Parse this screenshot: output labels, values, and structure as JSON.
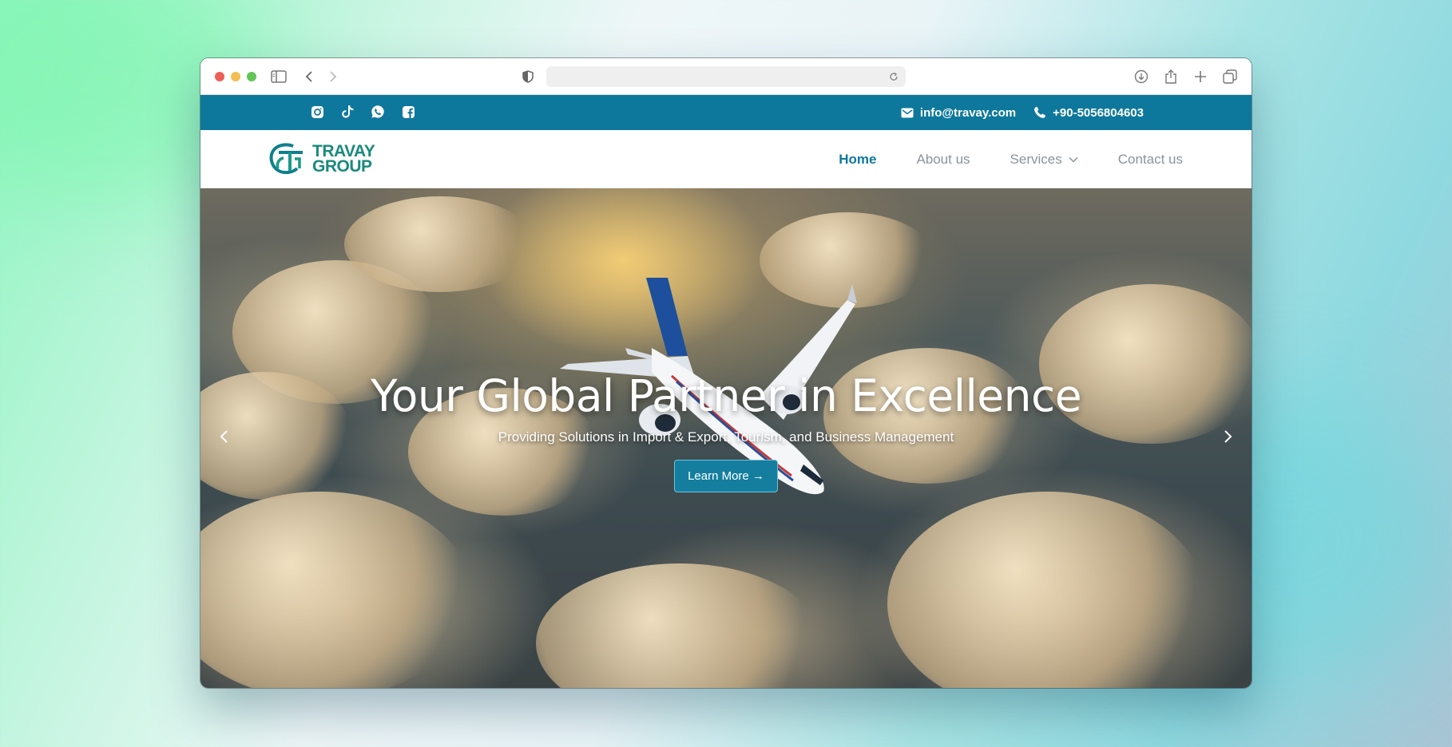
{
  "colors": {
    "brand": "#0e789c",
    "logo": "#1a8a7d",
    "nav_inactive": "#8a949b",
    "traffic_red": "#ee5f57",
    "traffic_yellow": "#f5bd4f",
    "traffic_green": "#61c454"
  },
  "browser": {
    "icons": [
      "sidebar-icon",
      "back-icon",
      "forward-icon",
      "shield-icon",
      "reload-icon",
      "download-icon",
      "share-icon",
      "new-tab-icon",
      "tabs-icon"
    ],
    "address": ""
  },
  "topbar": {
    "social": [
      "instagram-icon",
      "tiktok-icon",
      "whatsapp-icon",
      "facebook-icon"
    ],
    "email": "info@travay.com",
    "phone": "+90-5056804603"
  },
  "logo": {
    "line1": "TRAVAY",
    "line2": "GROUP"
  },
  "nav": {
    "home": "Home",
    "about": "About us",
    "services": "Services",
    "contact": "Contact us",
    "active": "Home"
  },
  "hero": {
    "title": "Your Global Partner in Excellence",
    "subtitle": "Providing Solutions in Import & Export, Tourism, and Business Management",
    "cta": "Learn More →"
  }
}
